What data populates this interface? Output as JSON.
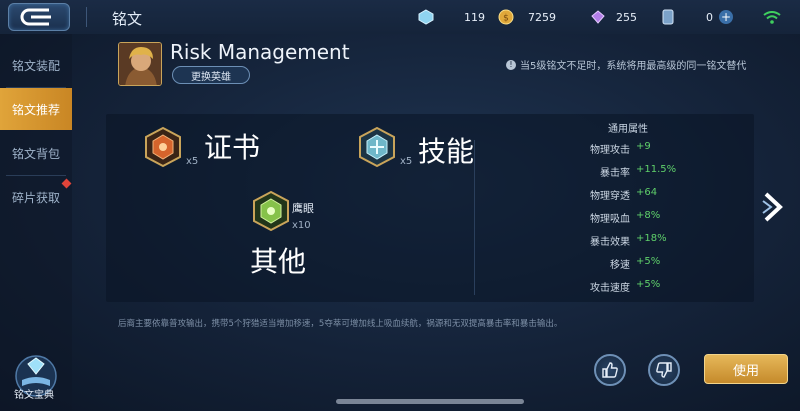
{
  "header": {
    "title": "铭文",
    "currencies": [
      {
        "icon": "blue-gem-icon",
        "value": "119"
      },
      {
        "icon": "gold-coin-icon",
        "value": "7259"
      },
      {
        "icon": "purple-crystal-icon",
        "value": "255"
      },
      {
        "icon": "voucher-icon",
        "value": "0"
      }
    ],
    "add_icon": "plus-icon",
    "signal_icon": "wifi-icon"
  },
  "sidebar": {
    "items": [
      {
        "label": "铭文装配",
        "active": false
      },
      {
        "label": "铭文推荐",
        "active": true
      },
      {
        "label": "铭文背包",
        "active": false
      },
      {
        "label": "碎片获取",
        "active": false,
        "badge": true
      }
    ]
  },
  "hero": {
    "name": "Risk Management",
    "change_button": "更换英雄",
    "notice": "当5级铭文不足时，系统将用最高级的同一铭文替代"
  },
  "runes": [
    {
      "label": "证书",
      "count": "x5",
      "icon": "red-rune-icon",
      "color": "#d5642c"
    },
    {
      "label": "技能",
      "count": "x5",
      "icon": "blue-rune-icon",
      "color": "#6fb7c9"
    },
    {
      "label": "其他",
      "name": "鹰眼",
      "count": "x10",
      "icon": "green-rune-icon",
      "color": "#86c24a"
    }
  ],
  "stats": {
    "title": "通用属性",
    "items": [
      {
        "name": "物理攻击",
        "value": "+9"
      },
      {
        "name": "暴击率",
        "value": "+11.5%"
      },
      {
        "name": "物理穿透",
        "value": "+64"
      },
      {
        "name": "物理吸血",
        "value": "+8%"
      },
      {
        "name": "暴击效果",
        "value": "+18%"
      },
      {
        "name": "移速",
        "value": "+5%"
      },
      {
        "name": "攻击速度",
        "value": "+5%"
      }
    ]
  },
  "description": "后裔主要依靠普攻输出，携带5个狩猎适当增加移速，5夺萃可增加线上吸血续航，祸源和无双提高暴击率和暴击输出。",
  "footer": {
    "codex_label": "铭文宝典",
    "use_button": "使用",
    "like_icon": "thumbs-up-icon",
    "dislike_icon": "thumbs-down-icon"
  },
  "colors": {
    "accent": "#d89a35",
    "positive": "#5fd06a",
    "background": "#142238"
  }
}
